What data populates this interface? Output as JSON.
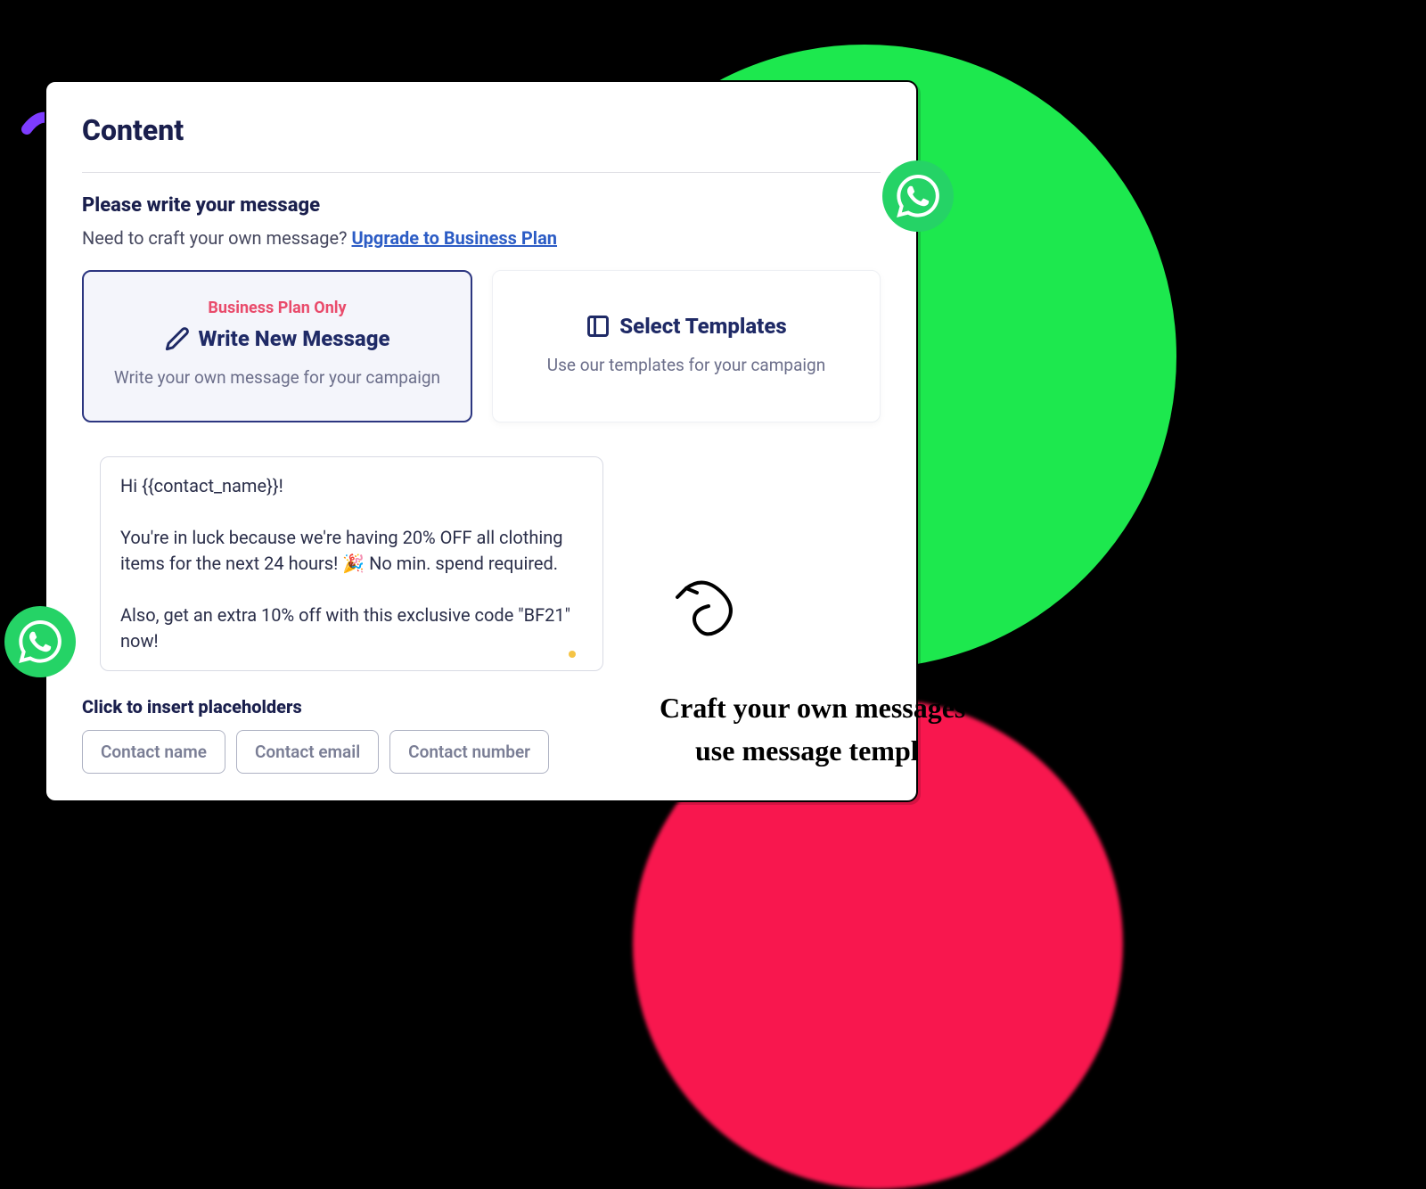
{
  "card": {
    "title": "Content",
    "subtitle": "Please write your message",
    "upgrade_prompt": "Need to craft your own message?  ",
    "upgrade_link": "Upgrade to Business Plan"
  },
  "options": {
    "write_new": {
      "badge": "Business Plan Only",
      "title": "Write New Message",
      "desc": "Write your own message for your campaign"
    },
    "templates": {
      "title": "Select Templates",
      "desc": "Use our templates for your campaign"
    }
  },
  "message_text": "Hi {{contact_name}}!\n\nYou're in luck because we're having 20% OFF all clothing items for the next 24 hours! 🎉 No min. spend required.\n\nAlso, get an extra 10% off with this exclusive code \"BF21\" now!",
  "placeholders": {
    "label": "Click to insert placeholders",
    "buttons": [
      "Contact name",
      "Contact email",
      "Contact number"
    ]
  },
  "annotation": {
    "line1": "Craft your own messages",
    "line2": "use message templ"
  },
  "colors": {
    "green": "#1de84e",
    "pink": "#f8174e",
    "whatsapp": "#25d366",
    "primary_text": "#1a1f4d",
    "accent_blue": "#2c5cc5",
    "badge_red": "#e94b6b"
  }
}
